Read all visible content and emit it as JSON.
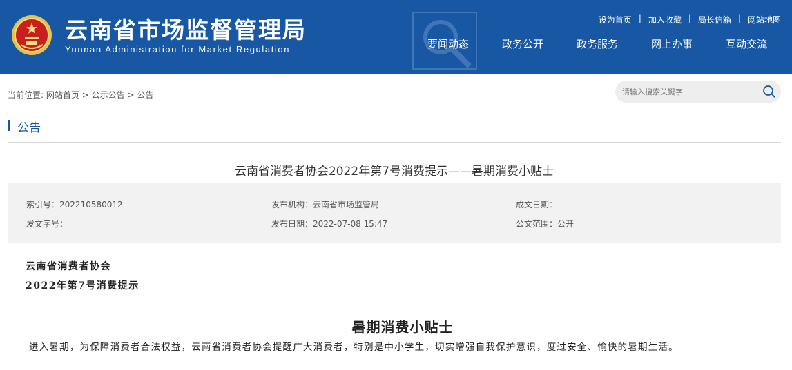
{
  "header": {
    "title": "云南省市场监督管理局",
    "subtitle": "Yunnan Administration for Market Regulation",
    "top_links": [
      "设为首页",
      "加入收藏",
      "局长信箱",
      "网站地图"
    ],
    "top_link_separator": "|",
    "nav": [
      "要闻动态",
      "政务公开",
      "政务服务",
      "网上办事",
      "互动交流"
    ],
    "colors": {
      "header_bg": "#1857a4",
      "emblem_red": "#c8201e",
      "emblem_gold": "#e8c34a"
    }
  },
  "breadcrumb": {
    "prefix": "当前位置:",
    "items": [
      "网站首页",
      "公示公告",
      "公告"
    ],
    "separator": ">"
  },
  "search": {
    "placeholder": "请输入搜索关键字",
    "icon": "search-icon"
  },
  "section": {
    "title": "公告"
  },
  "article": {
    "title": "云南省消费者协会2022年第7号消费提示——暑期消费小贴士",
    "meta": {
      "index_label": "索引号：",
      "index_value": "202210580012",
      "publisher_label": "发布机构：",
      "publisher_value": "云南省市场监管局",
      "date_made_label": "成文日期：",
      "date_made_value": "",
      "doc_number_label": "发文字号：",
      "doc_number_value": "",
      "publish_date_label": "发布日期：",
      "publish_date_value": "2022-07-08 15:47",
      "scope_label": "公文范围：",
      "scope_value": "公开"
    },
    "org_line": "云南省消费者协会",
    "number_line": "2022年第7号消费提示",
    "heading": "暑期消费小贴士",
    "paragraph": "进入暑期，为保障消费者合法权益，云南省消费者协会提醒广大消费者，特别是中小学生，切实增强自我保护意识，度过安全、愉快的暑期生活。"
  }
}
